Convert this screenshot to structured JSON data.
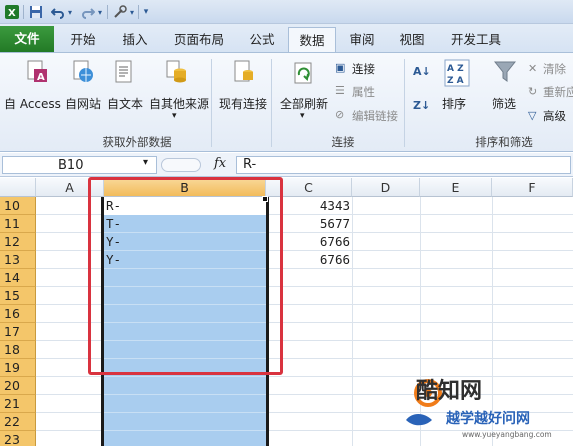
{
  "quick_access": {
    "icons": [
      "excel-app-icon",
      "save-icon",
      "undo-icon",
      "redo-icon",
      "tools-icon",
      "customize-icon"
    ]
  },
  "tabs": [
    {
      "label": "文件",
      "active": false,
      "file": true
    },
    {
      "label": "开始",
      "active": false
    },
    {
      "label": "插入",
      "active": false
    },
    {
      "label": "页面布局",
      "active": false
    },
    {
      "label": "公式",
      "active": false
    },
    {
      "label": "数据",
      "active": true
    },
    {
      "label": "审阅",
      "active": false
    },
    {
      "label": "视图",
      "active": false
    },
    {
      "label": "开发工具",
      "active": false
    }
  ],
  "ribbon": {
    "get_external": {
      "group_label": "获取外部数据",
      "buttons": [
        "自 Access",
        "自网站",
        "自文本",
        "自其他来源"
      ],
      "existing": "现有连接"
    },
    "connections": {
      "group_label": "连接",
      "refresh_all": "全部刷新",
      "connections": "连接",
      "properties": "属性",
      "edit_links": "编辑链接"
    },
    "sort_filter": {
      "group_label": "排序和筛选",
      "sort": "排序",
      "filter": "筛选",
      "clear": "清除",
      "reapply": "重新应",
      "advanced": "高级"
    }
  },
  "formula_bar": {
    "name_box": "B10",
    "fx": "fx",
    "formula": "R-"
  },
  "grid": {
    "columns": [
      "A",
      "B",
      "C",
      "D",
      "E",
      "F"
    ],
    "selected_column": "B",
    "rows": [
      "10",
      "11",
      "12",
      "13",
      "14",
      "15",
      "16",
      "17",
      "18",
      "19",
      "20",
      "21",
      "22",
      "23"
    ],
    "b_values": [
      "R-",
      "T-",
      "Y-",
      "Y-"
    ],
    "c_values": [
      "4343",
      "5677",
      "6766",
      "6766"
    ]
  },
  "colors": {
    "selection_fill": "#a9cdef",
    "row_header": "#f4c66a",
    "highlight_box": "#d9333f",
    "file_tab": "#2a872d"
  },
  "watermark": {
    "logo_main": "酷知网",
    "logo_sub": "越学越好问网",
    "url": "www.yueyangbang.com"
  }
}
